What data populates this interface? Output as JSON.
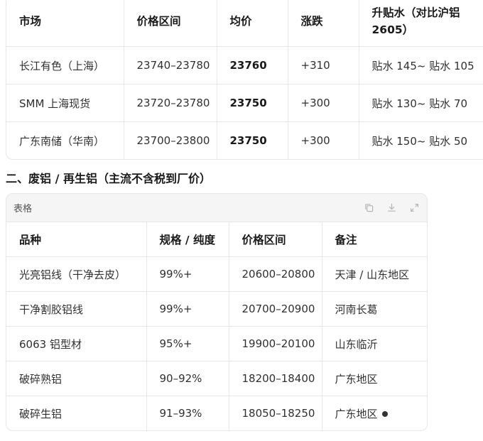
{
  "table1": {
    "headers": [
      "市场",
      "价格区间",
      "均价",
      "涨跌",
      "升贴水（对比沪铝 2605）"
    ],
    "rows": [
      [
        "长江有色（上海）",
        "23740–23780",
        "23760",
        "+310",
        "贴水 145~ 贴水 105"
      ],
      [
        "SMM 上海现货",
        "23720–23780",
        "23750",
        "+300",
        "贴水 130~ 贴水 70"
      ],
      [
        "广东南储（华南）",
        "23700–23800",
        "23750",
        "+300",
        "贴水 150~ 贴水 50"
      ]
    ]
  },
  "section2": {
    "heading": "二、废铝 / 再生铝（主流不含税到厂价）"
  },
  "table2": {
    "title": "表格",
    "tools": [
      "copy-icon",
      "download-icon",
      "expand-icon"
    ],
    "headers": [
      "品种",
      "规格 / 纯度",
      "价格区间",
      "备注"
    ],
    "rows": [
      [
        "光亮铝线（干净去皮）",
        "99%+",
        "20600–20800",
        "天津 / 山东地区"
      ],
      [
        "干净割胶铝线",
        "99%+",
        "20700–20900",
        "河南长葛"
      ],
      [
        "6063 铝型材",
        "95%+",
        "19900–20100",
        "山东临沂"
      ],
      [
        "破碎熟铝",
        "90–92%",
        "18200–18400",
        "广东地区"
      ],
      [
        "破碎生铝",
        "91–93%",
        "18050–18250",
        "广东地区"
      ]
    ]
  },
  "colors": {
    "border": "#e6e6e6",
    "header_bg": "#f5f5f6",
    "text": "#303030"
  }
}
